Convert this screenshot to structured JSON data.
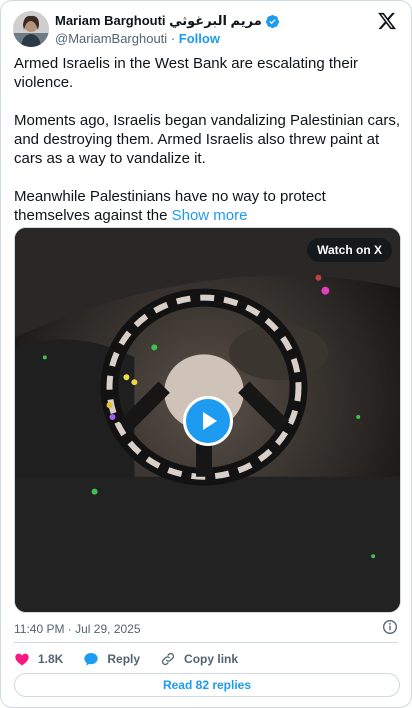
{
  "author": {
    "name": "Mariam Barghouti مريم البرغوثي",
    "handle": "@MariamBarghouti",
    "separator": "·",
    "follow_label": "Follow"
  },
  "tweet": {
    "paragraphs": [
      "Armed Israelis in the West Bank are escalating their violence.",
      "Moments ago, Israelis began vandalizing Palestinian cars, and destroying them. Armed Israelis also threw paint at cars as a way to vandalize it.",
      "Meanwhile Palestinians have no way to protect themselves against the"
    ],
    "show_more_label": "Show more"
  },
  "media": {
    "watch_label": "Watch on X"
  },
  "timestamp": "11:40 PM · Jul 29, 2025",
  "actions": {
    "likes": "1.8K",
    "reply_label": "Reply",
    "copy_link_label": "Copy link"
  },
  "read_replies_label": "Read 82 replies",
  "colors": {
    "accent": "#1d9bf0",
    "like": "#f91880",
    "text_secondary": "#536471"
  }
}
